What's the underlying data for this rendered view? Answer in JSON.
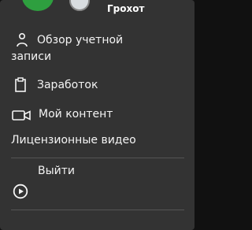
{
  "header": {
    "username": "Грохот"
  },
  "menu": {
    "overview_line1": "Обзор учетной",
    "overview_line2": "записи",
    "earnings": "Заработок",
    "content": "Мой контент",
    "licensed_videos": "Лицензионные видео",
    "logout": "Выйти"
  },
  "icons": {
    "account": "user-icon",
    "earnings": "clipboard-icon",
    "content": "video-camera-icon",
    "logout": "play-circle-icon"
  },
  "colors": {
    "panel": "#333333",
    "accent": "#2e9f3f",
    "text": "#f4f4f4"
  }
}
